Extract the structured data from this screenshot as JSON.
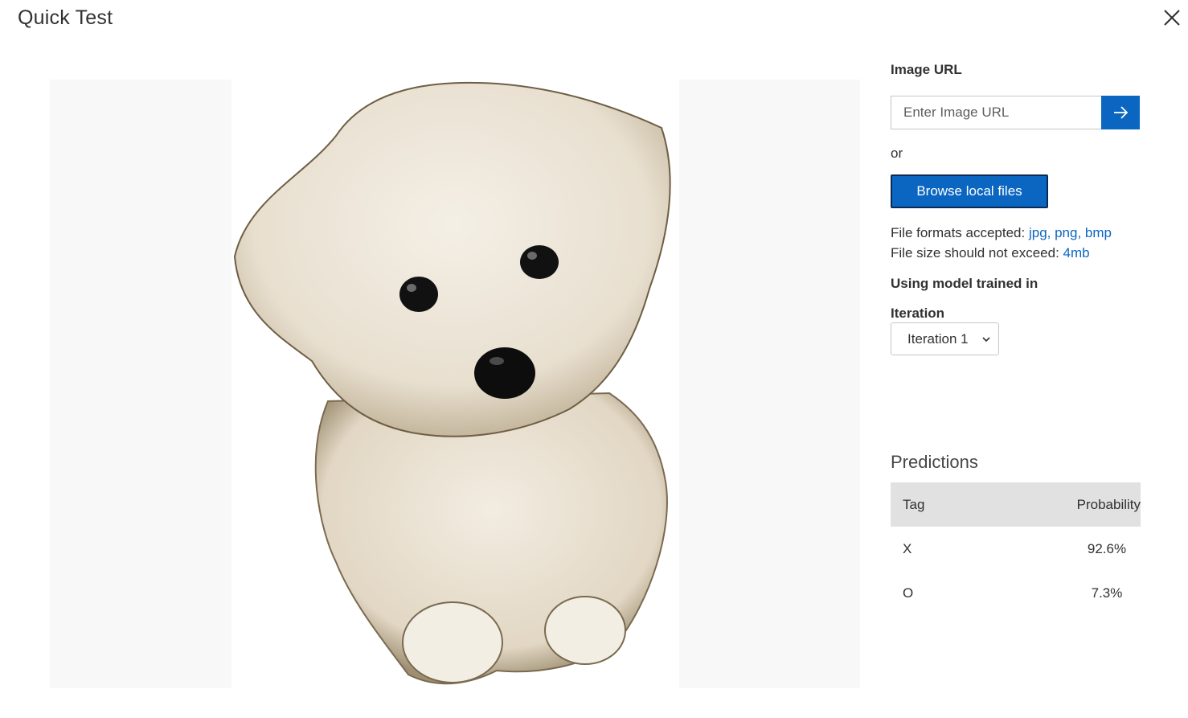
{
  "dialog": {
    "title": "Quick Test"
  },
  "preview": {
    "subject": "white fluffy puppy"
  },
  "panel": {
    "image_url_label": "Image URL",
    "image_url_placeholder": "Enter Image URL",
    "image_url_value": "",
    "or_text": "or",
    "browse_label": "Browse local files",
    "formats_prefix": "File formats accepted: ",
    "formats_value": "jpg, png, bmp",
    "size_prefix": "File size should not exceed: ",
    "size_value": "4mb",
    "model_label": "Using model trained in",
    "iteration_label": "Iteration",
    "iteration_selected": "Iteration 1"
  },
  "predictions": {
    "title": "Predictions",
    "columns": [
      "Tag",
      "Probability"
    ],
    "rows": [
      {
        "tag": "X",
        "probability": "92.6%"
      },
      {
        "tag": "O",
        "probability": "7.3%"
      }
    ]
  },
  "colors": {
    "accent": "#0b66c2",
    "header_bg": "#e1e1e1",
    "preview_bg": "#f8f8f8"
  },
  "icons": {
    "close": "close-icon",
    "go": "arrow-right-icon",
    "chevron": "chevron-down-icon"
  }
}
